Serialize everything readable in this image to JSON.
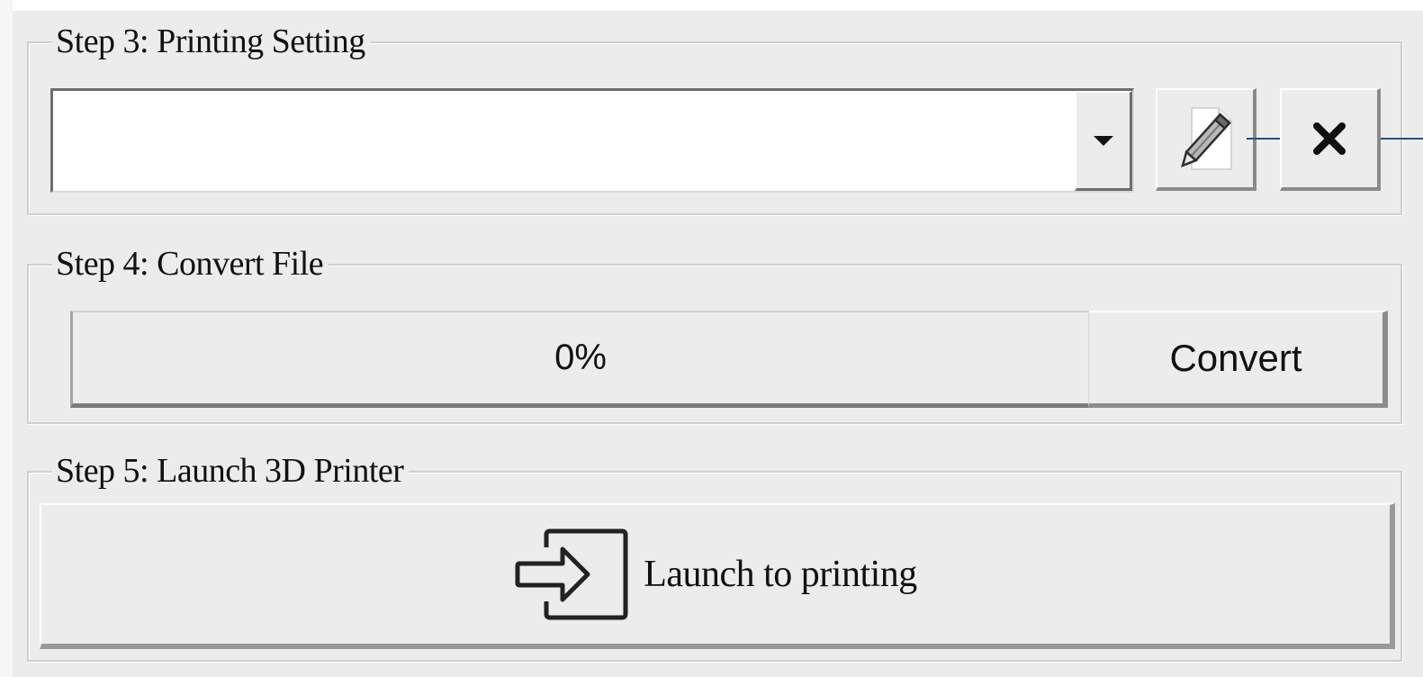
{
  "printing_setting": {
    "title": "Step 3: Printing Setting",
    "selected_value": "",
    "edit_icon": "pencil-page-icon",
    "delete_icon": "close-x-icon"
  },
  "convert_file": {
    "title": "Step 4: Convert File",
    "progress_text": "0%",
    "progress_fraction": 0,
    "button_label": "Convert"
  },
  "launch_printer": {
    "title": "Step 5: Launch 3D Printer",
    "button_label": "Launch to printing",
    "button_icon": "enter-arrow-icon"
  },
  "colors": {
    "background": "#ececec",
    "callout_line": "#2a4d70",
    "progress_fill": "#3a7bd5"
  }
}
